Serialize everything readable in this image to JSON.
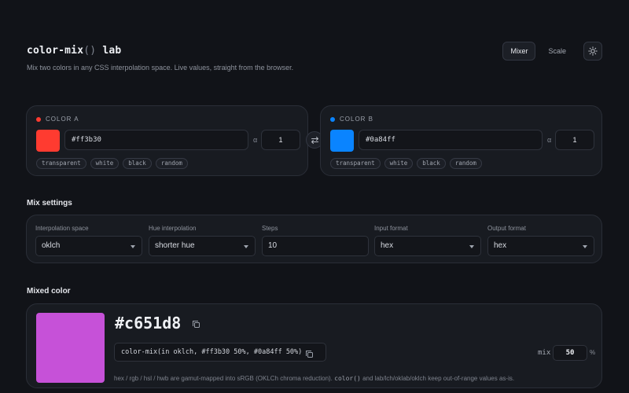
{
  "header": {
    "title_main": "color-mix",
    "title_paren": "()",
    "title_suffix": " lab",
    "subtitle": "Mix two colors in any CSS interpolation space. Live values, straight from the browser.",
    "nav": {
      "mixer": "Mixer",
      "scale": "Scale",
      "theme_icon": "sun-icon"
    }
  },
  "colors": {
    "accent_a": "#ff3b30",
    "accent_b": "#0a84ff",
    "background": "#111318",
    "panel": "#181b21"
  },
  "color_a": {
    "label": "COLOR A",
    "value": "#ff3b30",
    "alpha_label": "α",
    "alpha": "1",
    "chips": [
      "transparent",
      "white",
      "black",
      "random"
    ]
  },
  "color_b": {
    "label": "COLOR B",
    "value": "#0a84ff",
    "alpha_label": "α",
    "alpha": "1",
    "chips": [
      "transparent",
      "white",
      "black",
      "random"
    ]
  },
  "swap": {
    "icon": "swap-arrows-icon"
  },
  "settings": {
    "title": "Mix settings",
    "interpolation_space": {
      "label": "Interpolation space",
      "value": "oklch"
    },
    "hue_interpolation": {
      "label": "Hue interpolation",
      "value": "shorter hue"
    },
    "steps": {
      "label": "Steps",
      "value": "10"
    },
    "input_format": {
      "label": "Input format",
      "value": "hex"
    },
    "output_format": {
      "label": "Output format",
      "value": "hex"
    }
  },
  "mixed": {
    "title": "Mixed color",
    "hex": "#c651d8",
    "swatch_color": "#c651d8",
    "css": "color-mix(in oklch, #ff3b30 50%, #0a84ff 50%)",
    "mix_label": "mix",
    "mix_value": "50",
    "mix_unit": "%",
    "note_start": "hex / rgb / hsl / hwb are gamut-mapped into sRGB (OKLCh chroma reduction). ",
    "note_code": "color()",
    "note_end": " and lab/lch/oklab/oklch keep out-of-range values as-is."
  }
}
